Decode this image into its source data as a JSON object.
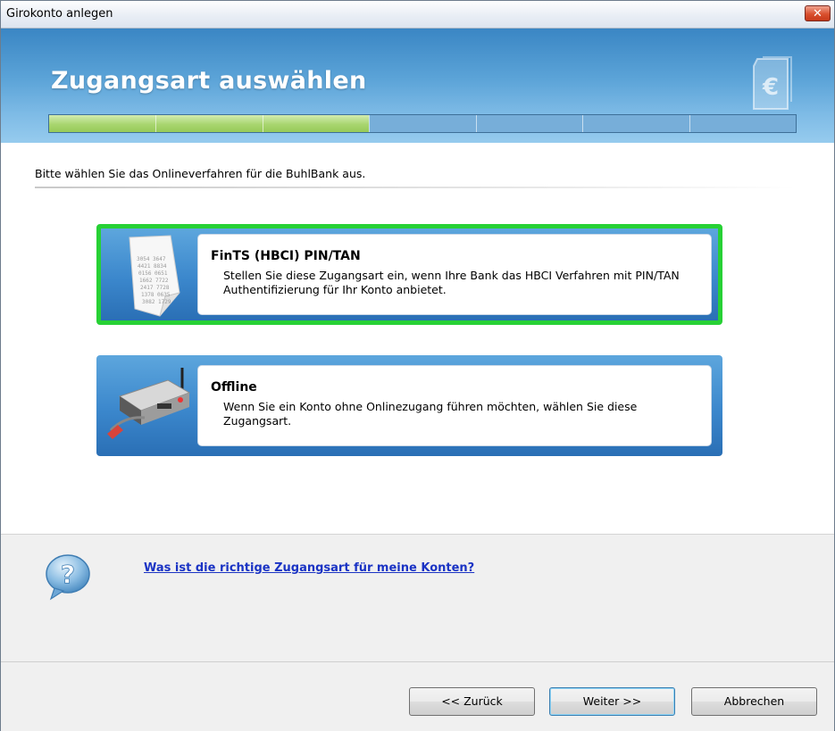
{
  "window": {
    "title": "Girokonto anlegen",
    "close_label": "✕"
  },
  "header": {
    "heading": "Zugangsart auswählen",
    "progress": {
      "segments_total": 7,
      "segments_completed": 3
    }
  },
  "instruction": "Bitte wählen Sie das Onlineverfahren für die BuhlBank aus.",
  "options": [
    {
      "title": "FinTS (HBCI) PIN/TAN",
      "description": "Stellen Sie diese Zugangsart ein, wenn Ihre Bank das HBCI Verfahren mit PIN/TAN Authentifizierung für Ihr Konto anbietet.",
      "selected": true,
      "icon": "tan-list-icon"
    },
    {
      "title": "Offline",
      "description": "Wenn Sie ein Konto ohne Onlinezugang führen möchten, wählen Sie diese Zugangsart.",
      "selected": false,
      "icon": "router-cable-icon"
    }
  ],
  "help": {
    "link_text": "Was ist die richtige Zugangsart für meine Konten?",
    "icon": "question-bubble-icon"
  },
  "buttons": {
    "back": "<< Zurück",
    "next": "Weiter >>",
    "cancel": "Abbrechen"
  },
  "colors": {
    "banner": "#5ca4d8",
    "progress_done": "#a8d56f",
    "selected_border": "#27d135",
    "link": "#1a33c4"
  }
}
